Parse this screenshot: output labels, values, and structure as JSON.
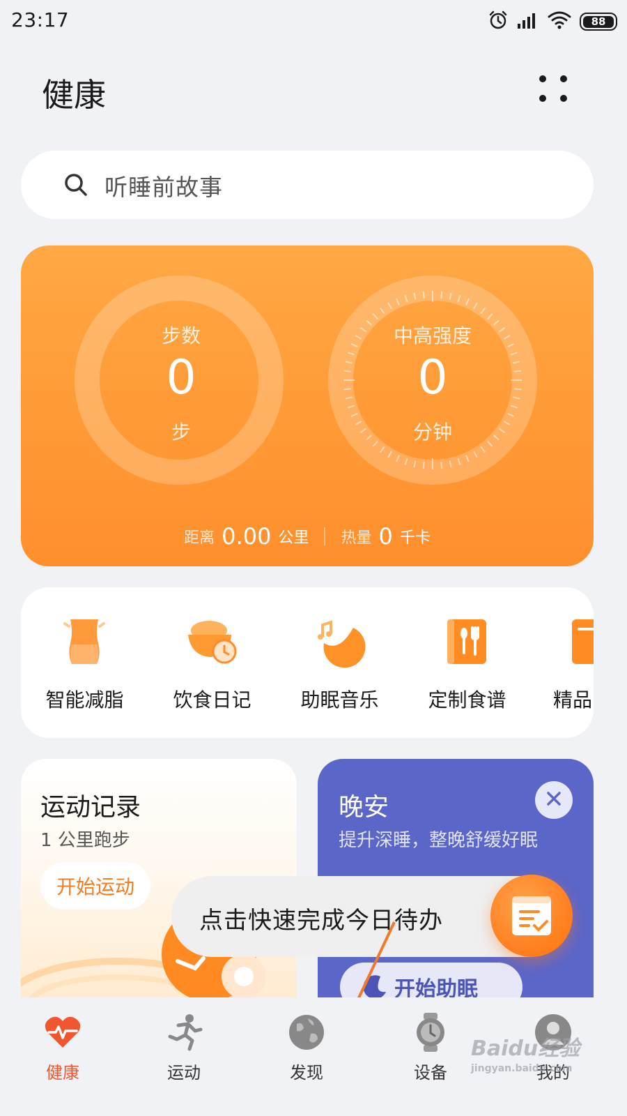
{
  "status_bar": {
    "time": "23:17",
    "battery": "88"
  },
  "header": {
    "title": "健康"
  },
  "search": {
    "text": "听睡前故事"
  },
  "summary": {
    "steps": {
      "label": "步数",
      "value": "0",
      "unit": "步"
    },
    "intensity": {
      "label": "中高强度",
      "value": "0",
      "unit": "分钟"
    },
    "distance": {
      "label": "距离",
      "value": "0.00",
      "unit": "公里"
    },
    "calories": {
      "label": "热量",
      "value": "0",
      "unit": "千卡"
    }
  },
  "shortcuts": [
    {
      "label": "智能减脂",
      "icon": "body-shape-icon"
    },
    {
      "label": "饮食日记",
      "icon": "food-bowl-clock-icon"
    },
    {
      "label": "助眠音乐",
      "icon": "moon-music-icon"
    },
    {
      "label": "定制食谱",
      "icon": "cutlery-book-icon"
    },
    {
      "label": "精品",
      "icon": "premium-icon"
    }
  ],
  "exercise_card": {
    "title": "运动记录",
    "subtitle": "1 公里跑步",
    "button": "开始运动"
  },
  "sleep_card": {
    "title": "晚安",
    "subtitle": "提升深睡，整晚舒缓好眠",
    "button": "开始助眠"
  },
  "tooltip": {
    "text": "点击快速完成今日待办"
  },
  "bottom_nav": [
    {
      "label": "健康",
      "icon": "heart-pulse-icon",
      "active": true
    },
    {
      "label": "运动",
      "icon": "runner-icon",
      "active": false
    },
    {
      "label": "发现",
      "icon": "globe-icon",
      "active": false
    },
    {
      "label": "设备",
      "icon": "watch-icon",
      "active": false
    },
    {
      "label": "我的",
      "icon": "profile-icon",
      "active": false
    }
  ],
  "watermark": {
    "brand": "Baidu经验",
    "url": "jingyan.baidu.com"
  },
  "colors": {
    "accent_orange": "#ff9a35",
    "nav_active": "#f0562f",
    "sleep_card": "#5b66c9",
    "background": "#f1f2f5"
  }
}
